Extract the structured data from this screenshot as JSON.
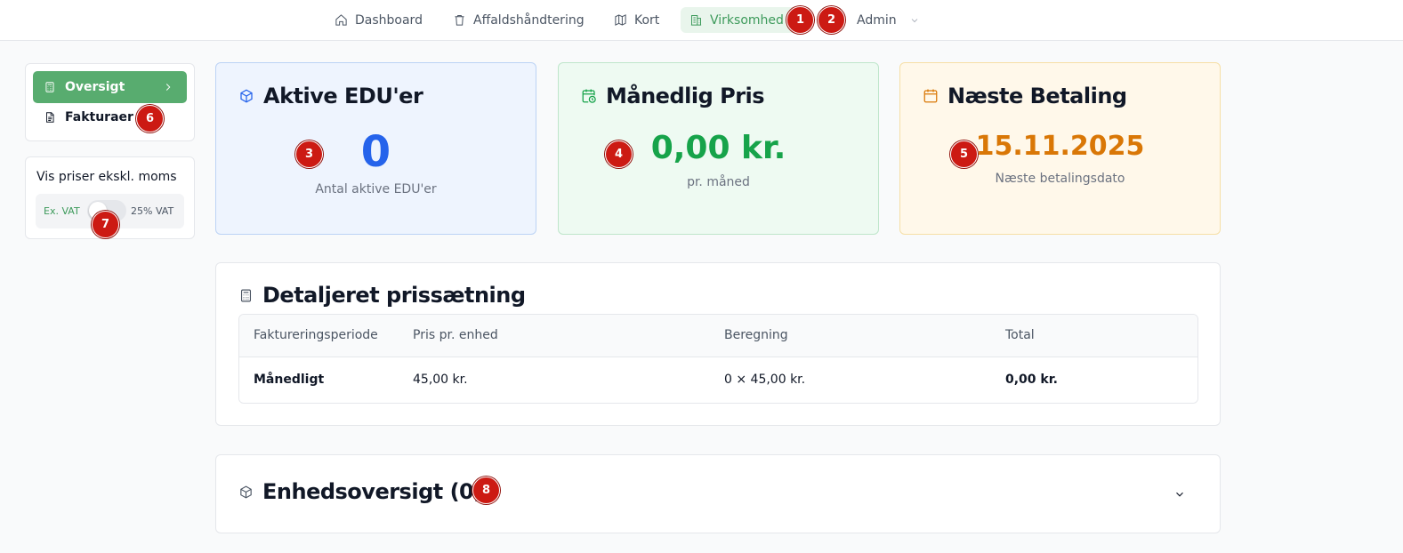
{
  "nav": {
    "dashboard": "Dashboard",
    "affald": "Affaldshåndtering",
    "kort": "Kort",
    "virksomhed": "Virksomhed",
    "admin": "Admin"
  },
  "sidebar": {
    "oversigt": "Oversigt",
    "fakturaer": "Fakturaer",
    "vat_title": "Vis priser ekskl. moms",
    "vat_ex": "Ex. VAT",
    "vat_inc": "25% VAT",
    "vat_toggle_on": false
  },
  "stats": {
    "edu": {
      "title": "Aktive EDU'er",
      "value": "0",
      "sub": "Antal aktive EDU'er"
    },
    "pris": {
      "title": "Månedlig Pris",
      "value": "0,00 kr.",
      "sub": "pr. måned"
    },
    "betaling": {
      "title": "Næste Betaling",
      "value": "15.11.2025",
      "sub": "Næste betalingsdato"
    }
  },
  "detail": {
    "title": "Detaljeret prissætning",
    "columns": [
      "Faktureringsperiode",
      "Pris pr. enhed",
      "Beregning",
      "Total"
    ],
    "rows": [
      [
        "Månedligt",
        "45,00 kr.",
        "0 × 45,00 kr.",
        "0,00 kr."
      ]
    ]
  },
  "enheds": {
    "title": "Enhedsoversigt (0)"
  },
  "badges": [
    "1",
    "2",
    "3",
    "4",
    "5",
    "6",
    "7",
    "8"
  ],
  "colors": {
    "accent_green": "#58ac6f",
    "blue": "#2563eb",
    "green": "#16a34a",
    "orange": "#d97706",
    "badge_red": "#cc1a13"
  },
  "icons": {
    "dashboard": "home-icon",
    "affald": "trash-icon",
    "kort": "map-icon",
    "virksomhed": "building-icon",
    "oversigt": "calculator-icon",
    "fakturaer": "file-text-icon",
    "edu": "package-icon",
    "pris": "calendar-clock-icon",
    "betaling": "calendar-icon",
    "detail": "calculator-icon",
    "enheds": "package-icon"
  }
}
